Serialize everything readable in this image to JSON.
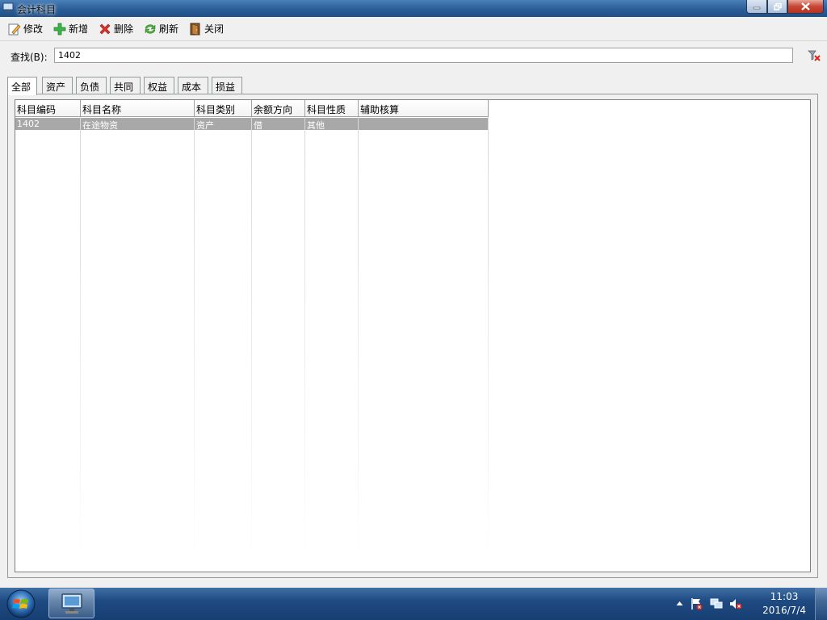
{
  "window": {
    "title": "会计科目"
  },
  "toolbar": {
    "edit_label": "修改",
    "add_label": "新增",
    "delete_label": "删除",
    "refresh_label": "刷新",
    "close_label": "关闭"
  },
  "find": {
    "label": "查找(B):",
    "value": "1402"
  },
  "tabs": [
    {
      "label": "全部"
    },
    {
      "label": "资产"
    },
    {
      "label": "负债"
    },
    {
      "label": "共同"
    },
    {
      "label": "权益"
    },
    {
      "label": "成本"
    },
    {
      "label": "损益"
    }
  ],
  "grid": {
    "columns": [
      "科目编码",
      "科目名称",
      "科目类别",
      "余额方向",
      "科目性质",
      "辅助核算"
    ],
    "rows": [
      [
        "1402",
        "在途物资",
        "资产",
        "借",
        "其他",
        ""
      ]
    ]
  },
  "taskbar": {
    "time": "11:03",
    "date": "2016/7/4"
  },
  "icons": {
    "app": "computer-icon",
    "edit": "pencil-icon",
    "add": "plus-icon",
    "delete": "x-icon",
    "refresh": "refresh-icon",
    "close": "door-icon",
    "clear": "clear-filter-icon",
    "start": "windows-orb-icon",
    "tray": [
      "tray-arrow-icon",
      "flag-icon",
      "network-icon",
      "volume-muted-icon"
    ]
  }
}
